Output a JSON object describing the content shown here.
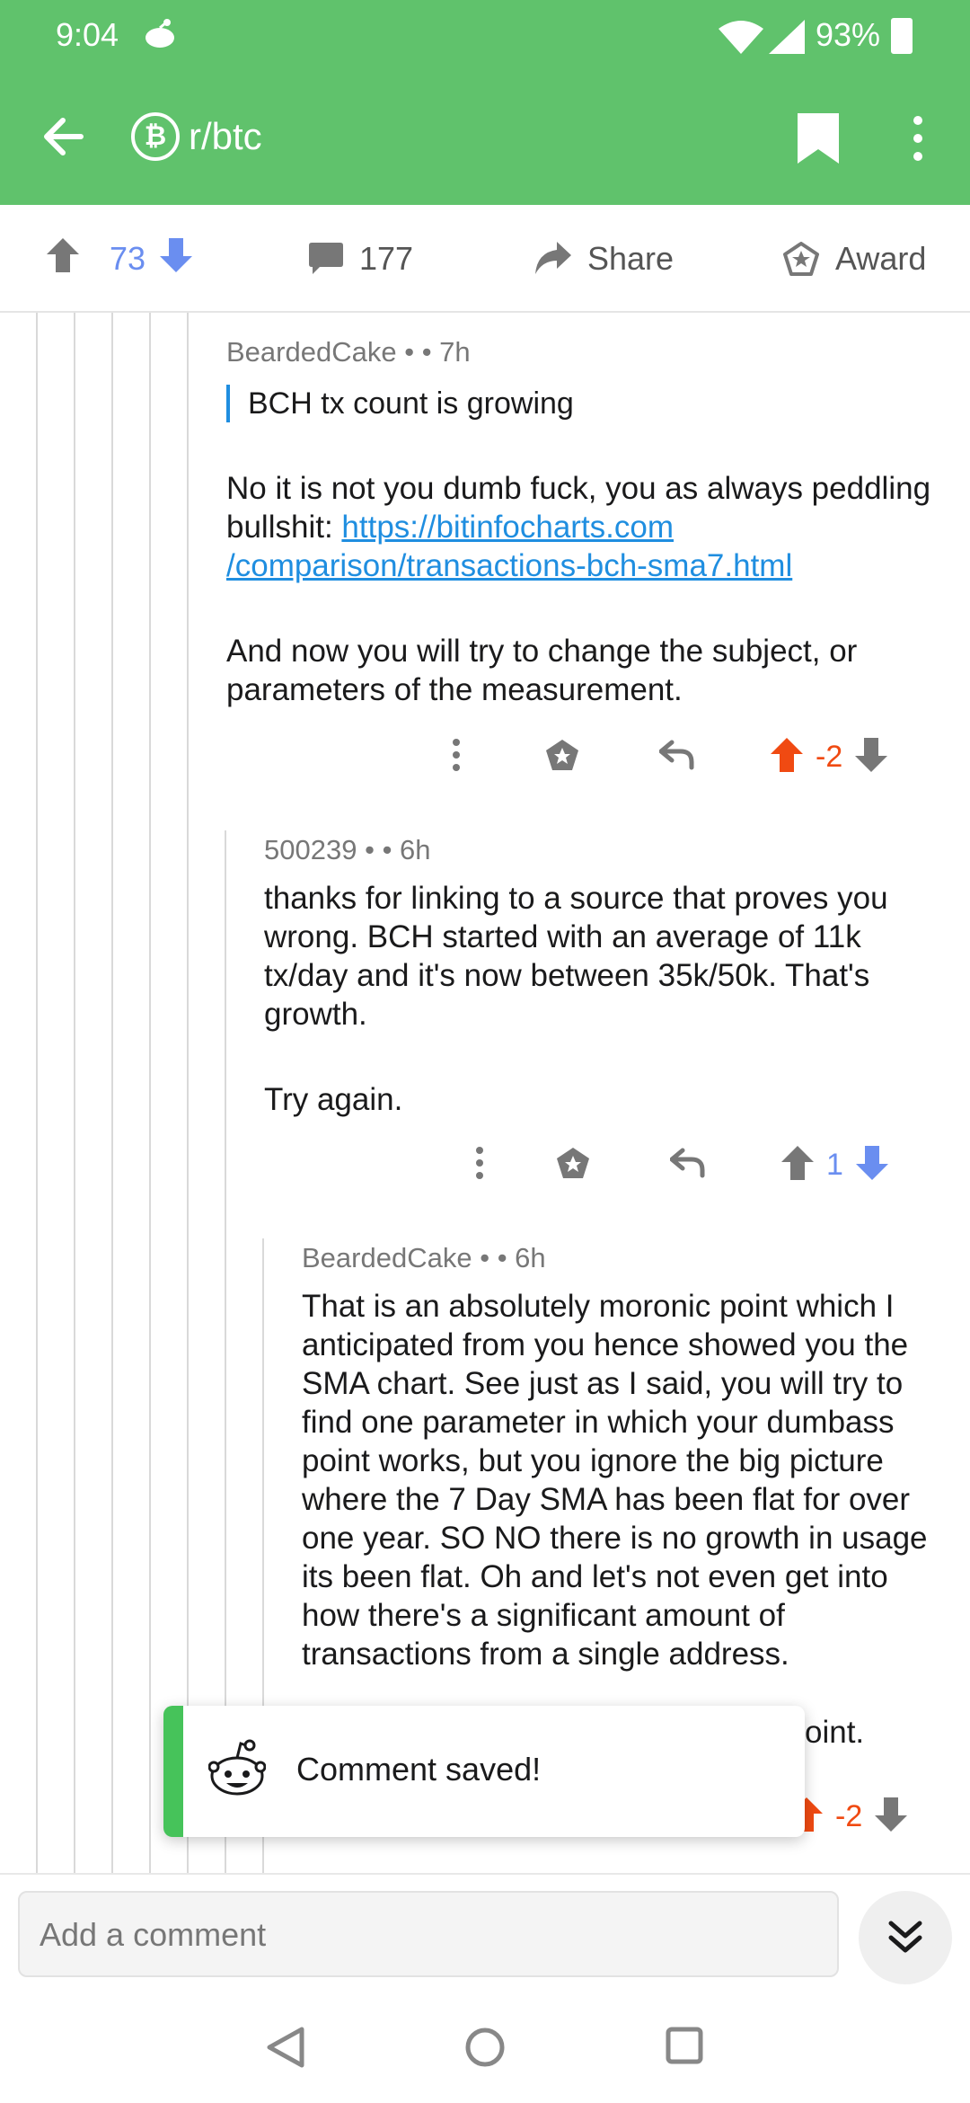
{
  "status": {
    "time": "9:04",
    "battery": "93%"
  },
  "appbar": {
    "subreddit": "r/btc"
  },
  "post_actions": {
    "score": "73",
    "comments": "177",
    "share": "Share",
    "award": "Award"
  },
  "comments": [
    {
      "author": "BeardedCake",
      "dot": "•",
      "age": "• 7h",
      "quote": "BCH tx count is growing",
      "body1": "No it is not you dumb fuck, you as always peddling bullshit: ",
      "link1": "https://bitinfocharts.com",
      "link2": "/comparison/transactions-bch-sma7.html",
      "body2": "And now you will try to change the subject, or parameters of the measurement.",
      "score": "-2"
    },
    {
      "author": "500239",
      "dot": "•",
      "age": "• 6h",
      "body1": "thanks for linking to a source that proves you wrong. BCH started with an average of 11k tx/day and it's now between 35k/50k. That's growth.",
      "body2": "Try again.",
      "score": "1"
    },
    {
      "author": "BeardedCake",
      "dot": "•",
      "age": "• 6h",
      "body1": "That is an absolutely moronic point which I anticipated from you hence showed you the SMA chart. See just as I said, you will try to find one parameter in which your dumbass point works, but you ignore the big picture where the 7 Day SMA has been flat for over one year. SO NO there is no growth in usage its been flat. Oh and let's not even get into how there's a significant amount of transactions from a single address.",
      "body2_partial": "oint.",
      "score": "-2"
    }
  ],
  "toast": {
    "message": "Comment saved!"
  },
  "composer": {
    "placeholder": "Add a comment"
  },
  "colors": {
    "appbar": "#60c26c",
    "upvote": "#f04a12",
    "downvote": "#6a8ef0",
    "link": "#1f8ee0"
  }
}
